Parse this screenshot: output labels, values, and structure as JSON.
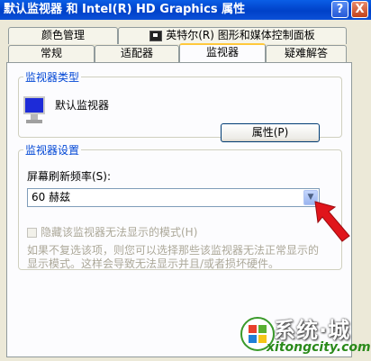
{
  "window": {
    "title": "默认监视器 和 Intel(R) HD Graphics 属性",
    "help_glyph": "?",
    "close_glyph": "X"
  },
  "tabs": {
    "top_row": [
      {
        "label": "颜色管理"
      },
      {
        "label": "英特尔(R) 图形和媒体控制面板",
        "icon": "display-icon"
      }
    ],
    "bottom_row": [
      {
        "label": "常规"
      },
      {
        "label": "适配器"
      },
      {
        "label": "监视器",
        "active": true
      },
      {
        "label": "疑难解答"
      }
    ]
  },
  "monitor_type": {
    "legend": "监视器类型",
    "monitor_name": "默认监视器",
    "properties_button": "属性(P)"
  },
  "monitor_settings": {
    "legend": "监视器设置",
    "refresh_label": "屏幕刷新频率(S):",
    "refresh_value": "60 赫兹",
    "hide_modes_label": "隐藏该监视器无法显示的模式(H)",
    "hide_modes_checked": false,
    "description": "如果不复选该项，则您可以选择那些该监视器无法正常显示的显示模式。这样会导致无法显示并且/或者损坏硬件。"
  },
  "watermark": {
    "title": "系统·城",
    "url": "xitongcity.com"
  },
  "colors": {
    "title_bar": "#0041c8",
    "group_legend": "#0046d5",
    "active_tab_accent": "#ffc83c",
    "disabled_text": "#aca899",
    "annotation_arrow": "#e0151b"
  }
}
